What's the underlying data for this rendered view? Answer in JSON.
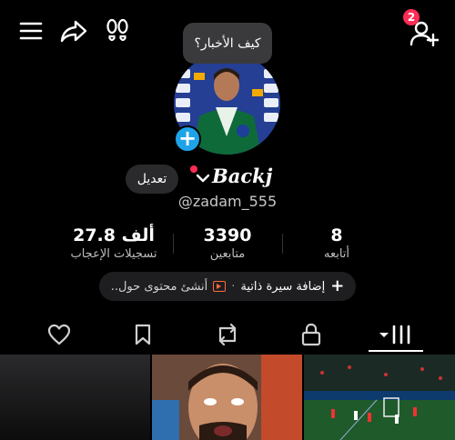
{
  "header": {
    "notification_count": "2",
    "icons": [
      "menu-icon",
      "share-icon",
      "footprints-icon",
      "add-user-icon"
    ]
  },
  "profile": {
    "speech_bubble": "كيف الأخبار؟",
    "edit_label": "تعديل",
    "display_name": "Backj",
    "username": "@zadam_555"
  },
  "stats": {
    "following": {
      "value": "8",
      "label": "أتابعه"
    },
    "followers": {
      "value": "3390",
      "label": "متابعين"
    },
    "likes": {
      "value": "27.8 ألف",
      "label": "تسجيلات الإعجاب"
    }
  },
  "bio": {
    "add_label": "إضافة سيرة ذاتية",
    "separator": "·",
    "create_label": "أنشئ محتوى حول.."
  },
  "tabs": [
    "videos-grid-tab",
    "private-tab",
    "reposts-tab",
    "favorites-tab",
    "liked-tab"
  ],
  "colors": {
    "background": "#000000",
    "badge": "#ff2c55",
    "avatar_plus": "#1fa3e8",
    "accent_orange": "#ff6a3d"
  }
}
